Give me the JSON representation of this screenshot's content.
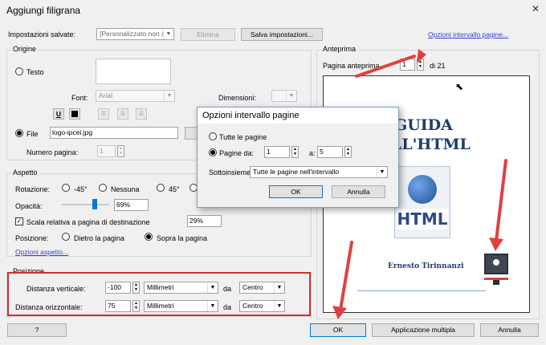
{
  "window": {
    "title": "Aggiungi filigrana",
    "close_glyph": "✕"
  },
  "saved": {
    "label": "Impostazioni salvate:",
    "value": "[Personalizzato non sal",
    "delete": "Elimina",
    "save": "Salva impostazioni...",
    "range_link": "Opzioni intervallo pagine..."
  },
  "origin": {
    "title": "Origine",
    "text_label": "Testo",
    "font_label": "Font:",
    "font_value": "Arial",
    "size_label": "Dimensioni:",
    "underline": "U",
    "file_label": "File",
    "file_value": "logo-ipcei.jpg",
    "page_label": "Numero pagina:",
    "page_value": "1"
  },
  "aspect": {
    "title": "Aspetto",
    "rotation_label": "Rotazione:",
    "rot_m45": "-45°",
    "rot_none": "Nessuna",
    "rot_45": "45°",
    "opacity_label": "Opacità:",
    "opacity_value": "69%",
    "opacity_level": 0.69,
    "scale_label": "Scala relativa a pagina di destinazione",
    "scale_value": "29%",
    "position_label": "Posizione:",
    "behind": "Dietro la pagina",
    "over": "Sopra la pagina",
    "link": "Opzioni aspetto..."
  },
  "position": {
    "title": "Posizione",
    "vertical_label": "Distanza verticale:",
    "vertical_value": "-100",
    "vertical_unit": "Millimetri",
    "vertical_from_label": "da",
    "vertical_from": "Centro",
    "horizontal_label": "Distanza orizzontale:",
    "horizontal_value": "75",
    "horizontal_unit": "Millimetri",
    "horizontal_from_label": "da",
    "horizontal_from": "Centro"
  },
  "preview": {
    "title": "Anteprima",
    "page_label": "Pagina anteprima",
    "page_value": "1",
    "page_total": "di 21",
    "doc_title_1": "GUIDA",
    "doc_title_2": "NELL'HTML",
    "html_label": "HTML",
    "author": "Ernesto Tirinnanzi"
  },
  "dialog": {
    "title": "Opzioni intervallo pagine",
    "all_pages": "Tutte le pagine",
    "pages_from": "Pagine da:",
    "from_value": "1",
    "to_label": "a:",
    "to_value": "5",
    "subset_label": "Sottoinsieme:",
    "subset_value": "Tutte le pagine nell'intervallo",
    "ok": "OK",
    "cancel": "Annulla"
  },
  "footer": {
    "help": "?",
    "ok": "OK",
    "multi": "Applicazione multipla",
    "cancel": "Annulla"
  },
  "colors": {
    "annotation": "#e04040",
    "title_blue": "#1f3a6e",
    "link": "#3c3cd9"
  }
}
